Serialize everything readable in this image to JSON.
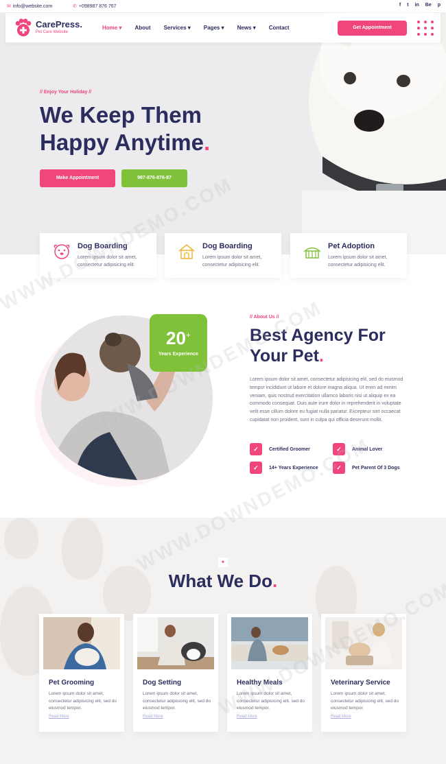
{
  "topbar": {
    "email": "info@website.com",
    "phone": "+098987 876 767",
    "social": [
      "f",
      "t",
      "in",
      "Be",
      "p"
    ]
  },
  "header": {
    "logo_name": "CarePress.",
    "logo_tagline": "Pet Care Website",
    "nav": [
      "Home",
      "About",
      "Services",
      "Pages",
      "News",
      "Contact"
    ],
    "cta": "Get Appointment"
  },
  "hero": {
    "eyebrow": "//  Enjoy Your Holiday  //",
    "title_line1": "We Keep Them",
    "title_line2": "Happy Anytime",
    "title_dot": ".",
    "btn_primary": "Make Appointment",
    "btn_secondary": "987-876-876-87"
  },
  "features": [
    {
      "title": "Dog Boarding",
      "desc": "Lorem ipsum dolor sit amet, consectetur adipisicing elit.",
      "icon": "dog-face-icon"
    },
    {
      "title": "Dog Boarding",
      "desc": "Lorem ipsum dolor sit amet, consectetur adipisicing elit.",
      "icon": "dog-house-icon"
    },
    {
      "title": "Pet Adoption",
      "desc": "Lorem ipsum dolor sit amet, consectetur adipisicing elit.",
      "icon": "kennel-icon"
    }
  ],
  "about": {
    "eyebrow": "//  About Us  //",
    "badge_number": "20",
    "badge_plus": "+",
    "badge_label": "Years Experience",
    "title_line1": "Best Agency For",
    "title_line2": "Your Pet",
    "title_dot": ".",
    "paragraph": "Lorem ipsum dolor sit amet, consectetur adipisicing elit, sed do eiusmod tempor incididunt ut labore et dolore magna aliqua. Ut enim ad minim veniam, quis nostrud exercitation ullamco laboris nisi ut aliquip ex ea commodo consequat. Duis aute irure dolor in reprehenderit in voluptate velit esse cillum dolore eu fugiat nulla pariatur. Excepteur sint occaecat cupidatat non proident, sunt in culpa qui officia deserunt mollit.",
    "checks": [
      "Certified Groomer",
      "Animal Lover",
      "14+ Years Experience",
      "Pet Parent Of 3 Dogs"
    ]
  },
  "services": {
    "title": "What We Do",
    "title_dot": ".",
    "items": [
      {
        "title": "Pet Grooming",
        "desc": "Lorem ipsum dolor sit amet, consectetur adipisicing elit, sed do eiusmod tempor.",
        "more": "Read More"
      },
      {
        "title": "Dog Setting",
        "desc": "Lorem ipsum dolor sit amet, consectetur adipisicing elit, sed do eiusmod tempor.",
        "more": "Read More"
      },
      {
        "title": "Healthy Meals",
        "desc": "Lorem ipsum dolor sit amet, consectetur adipisicing elit, sed do eiusmod tempor.",
        "more": "Read More"
      },
      {
        "title": "Veterinary Service",
        "desc": "Lorem ipsum dolor sit amet, consectetur adipisicing elit, sed do eiusmod tempor.",
        "more": "Read More"
      }
    ]
  },
  "watermark": "WWW.DOWNDEMO.COM",
  "colors": {
    "accent": "#f0467b",
    "green": "#7fc23a",
    "navy": "#2b2d5e"
  }
}
